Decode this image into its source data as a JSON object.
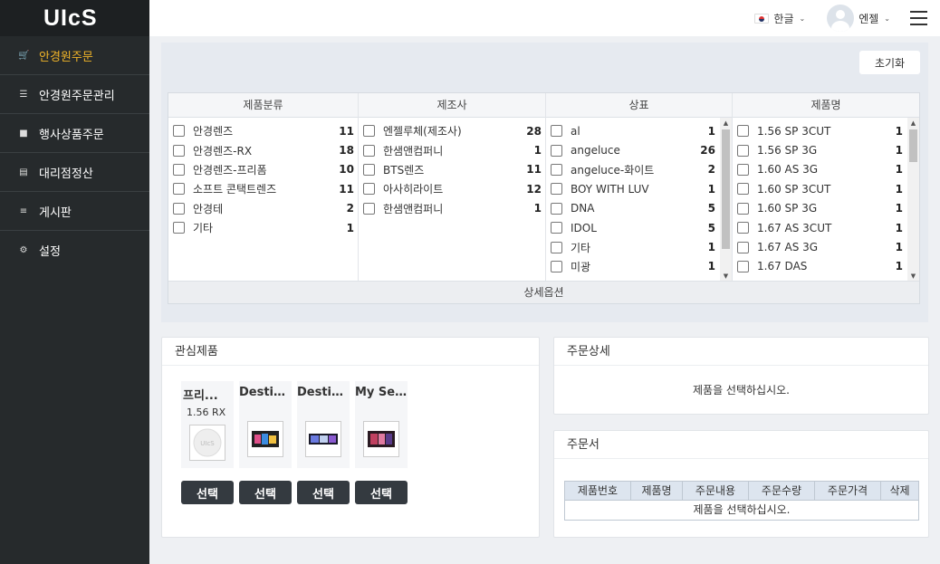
{
  "brand": {
    "logo": "UIcS"
  },
  "sidebar": {
    "items": [
      {
        "label": "안경원주문",
        "icon": "cart-icon",
        "active": true
      },
      {
        "label": "안경원주문관리",
        "icon": "list-manage-icon",
        "active": false
      },
      {
        "label": "행사상품주문",
        "icon": "cart-icon",
        "active": false
      },
      {
        "label": "대리점정산",
        "icon": "receipt-icon",
        "active": false
      },
      {
        "label": "게시판",
        "icon": "list-icon",
        "active": false
      },
      {
        "label": "설정",
        "icon": "gear-icon",
        "active": false
      }
    ]
  },
  "header": {
    "language": "한글",
    "user_name": "엔젤"
  },
  "filters": {
    "reset_label": "초기화",
    "detail_option_label": "상세옵션",
    "columns": [
      {
        "title": "제품분류",
        "rows": [
          {
            "label": "안경렌즈",
            "count": "11"
          },
          {
            "label": "안경렌즈-RX",
            "count": "18"
          },
          {
            "label": "안경렌즈-프리폼",
            "count": "10"
          },
          {
            "label": "소프트 콘택트렌즈",
            "count": "11"
          },
          {
            "label": "안경테",
            "count": "2"
          },
          {
            "label": "기타",
            "count": "1"
          }
        ]
      },
      {
        "title": "제조사",
        "rows": [
          {
            "label": "엔젤루체(제조사)",
            "count": "28"
          },
          {
            "label": "한샘앤컴퍼니",
            "count": "1"
          },
          {
            "label": "BTS렌즈",
            "count": "11"
          },
          {
            "label": "아사히라이트",
            "count": "12"
          },
          {
            "label": "한샘앤컴퍼니",
            "count": "1"
          }
        ]
      },
      {
        "title": "상표",
        "rows": [
          {
            "label": "al",
            "count": "1"
          },
          {
            "label": "angeluce",
            "count": "26"
          },
          {
            "label": "angeluce-화이트",
            "count": "2"
          },
          {
            "label": "BOY WITH LUV",
            "count": "1"
          },
          {
            "label": "DNA",
            "count": "5"
          },
          {
            "label": "IDOL",
            "count": "5"
          },
          {
            "label": "기타",
            "count": "1"
          },
          {
            "label": "미광",
            "count": "1"
          }
        ]
      },
      {
        "title": "제품명",
        "rows": [
          {
            "label": "1.56 SP 3CUT",
            "count": "1"
          },
          {
            "label": "1.56 SP 3G",
            "count": "1"
          },
          {
            "label": "1.60 AS 3G",
            "count": "1"
          },
          {
            "label": "1.60 SP 3CUT",
            "count": "1"
          },
          {
            "label": "1.60 SP 3G",
            "count": "1"
          },
          {
            "label": "1.67 AS 3CUT",
            "count": "1"
          },
          {
            "label": "1.67 AS 3G",
            "count": "1"
          },
          {
            "label": "1.67 DAS",
            "count": "1"
          }
        ]
      }
    ]
  },
  "favorites": {
    "title": "관심제품",
    "select_label": "선택",
    "items": [
      {
        "name": "프리...",
        "sub": "1.56 RX"
      },
      {
        "name": "Destin...",
        "sub": ""
      },
      {
        "name": "Destin...",
        "sub": ""
      },
      {
        "name": "My Se...",
        "sub": ""
      }
    ]
  },
  "order_detail": {
    "title": "주문상세",
    "message": "제품을 선택하십시오."
  },
  "order_form": {
    "title": "주문서",
    "columns": [
      "제품번호",
      "제품명",
      "주문내용",
      "주문수량",
      "주문가격",
      "삭제"
    ],
    "empty_message": "제품을 선택하십시오."
  }
}
